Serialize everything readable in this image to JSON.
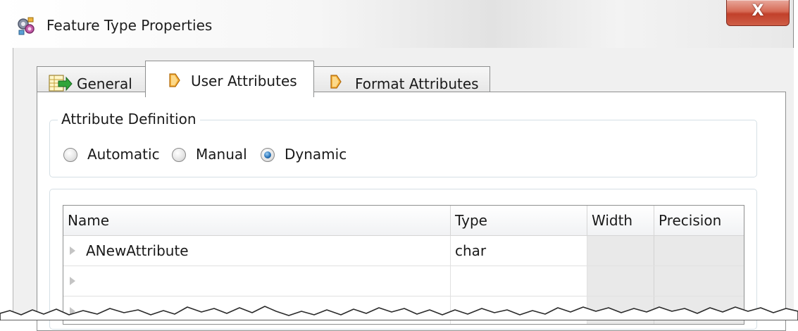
{
  "window": {
    "title": "Feature Type Properties",
    "close_label": "X",
    "icon": "feature-type-gear-icon"
  },
  "tabs": [
    {
      "label": "General",
      "icon": "general-table-arrow-icon",
      "active": false
    },
    {
      "label": "User Attributes",
      "icon": "attribute-diamond-icon",
      "active": true
    },
    {
      "label": "Format Attributes",
      "icon": "attribute-diamond-icon",
      "active": false
    }
  ],
  "attribute_definition": {
    "title": "Attribute Definition",
    "options": [
      {
        "label": "Automatic",
        "checked": false
      },
      {
        "label": "Manual",
        "checked": false
      },
      {
        "label": "Dynamic",
        "checked": true
      }
    ]
  },
  "grid": {
    "columns": [
      "Name",
      "Type",
      "Width",
      "Precision"
    ],
    "rows": [
      {
        "name": "ANewAttribute",
        "type": "char",
        "width": "",
        "precision": ""
      },
      {
        "name": "",
        "type": "",
        "width": "",
        "precision": ""
      },
      {
        "name": "",
        "type": "",
        "width": "",
        "precision": ""
      }
    ]
  },
  "colors": {
    "close_button": "#c9452f",
    "tab_icon_orange": "#f0a030",
    "radio_checked": "#2a74b9",
    "disabled_cell": "#e9e9e9"
  }
}
